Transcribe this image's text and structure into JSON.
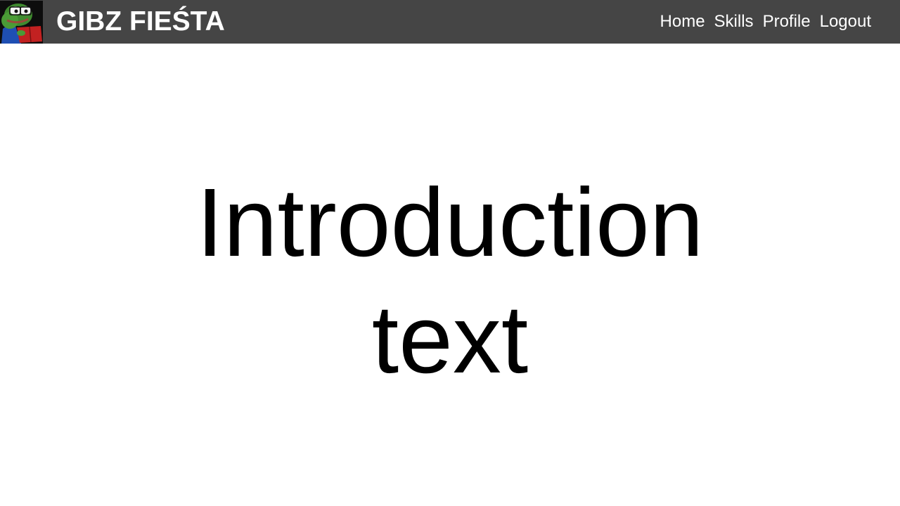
{
  "header": {
    "brand": "GIBZ FIEŚTA",
    "logo_icon": "pepe-frog-reading-icon",
    "nav": [
      {
        "label": "Home"
      },
      {
        "label": "Skills"
      },
      {
        "label": "Profile"
      },
      {
        "label": "Logout"
      }
    ]
  },
  "main": {
    "intro_text": "Introduction text"
  },
  "colors": {
    "navbar_bg": "#454545",
    "nav_text": "#ffffff",
    "body_text": "#000000",
    "page_bg": "#ffffff"
  }
}
